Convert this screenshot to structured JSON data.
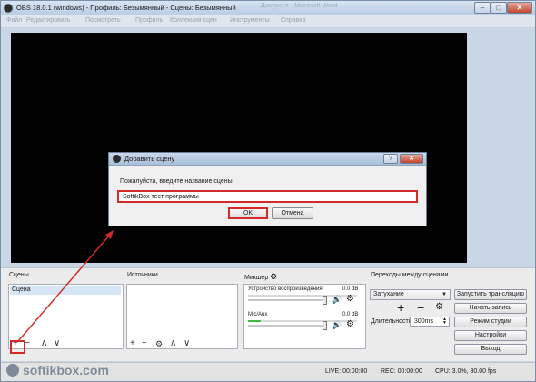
{
  "window": {
    "title": "OBS 18.0.1 (windows) - Профиль: Безымянный - Сцены: Безымянный",
    "ghost_tab": "Документ - Microsoft Word"
  },
  "menu": [
    "Файл",
    "Редактировать",
    "Посмотреть",
    "Профиль",
    "Коллекция сцен",
    "Инструменты",
    "Справка"
  ],
  "dialog": {
    "title": "Добавить сцену",
    "help": "?",
    "close": "✕",
    "prompt": "Пожалуйста, введите название сцены",
    "input_value": "SoftikBox тест программы",
    "ok": "OK",
    "cancel": "Отмена"
  },
  "scenes": {
    "title": "Сцены",
    "items": [
      "Сцена"
    ],
    "controls": [
      "+",
      "−",
      "∧",
      "∨"
    ]
  },
  "sources": {
    "title": "Источники",
    "controls": [
      "+",
      "−",
      "⚙",
      "∧",
      "∨"
    ]
  },
  "mixer": {
    "title": "Микшер",
    "channels": [
      {
        "name": "Устройство воспроизведения",
        "db": "0.0 dB"
      },
      {
        "name": "Mic/Aux",
        "db": "0.0 dB"
      }
    ]
  },
  "transitions": {
    "title": "Переходы между сценами",
    "selected": "Затухание",
    "duration_label": "Длительность",
    "duration_value": "300ms",
    "add": "+",
    "remove": "−"
  },
  "buttons": {
    "start_stream": "Запустить трансляцию",
    "start_record": "Начать запись",
    "studio_mode": "Режим студии",
    "settings": "Настройки",
    "exit": "Выход"
  },
  "status": {
    "live": "LIVE: 00:00:00",
    "rec": "REC: 00:00:00",
    "cpu": "CPU: 3.0%, 30.00 fps"
  },
  "watermark": "softikbox.com",
  "colors": {
    "highlight": "#d32a2a",
    "preview": "#000000",
    "meter_green": "#3cbc3c"
  }
}
